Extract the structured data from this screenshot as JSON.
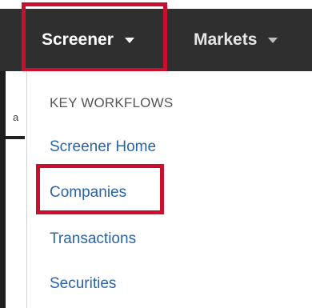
{
  "navbar": {
    "items": [
      {
        "label": "Screener",
        "active": true
      },
      {
        "label": "Markets",
        "active": false
      }
    ]
  },
  "background_page": {
    "visible_fragment": "a"
  },
  "dropdown": {
    "heading": "KEY WORKFLOWS",
    "items": [
      {
        "label": "Screener Home"
      },
      {
        "label": "Companies",
        "highlighted": true
      },
      {
        "label": "Transactions"
      },
      {
        "label": "Securities"
      }
    ]
  },
  "colors": {
    "navbar_bg": "#2f2f2f",
    "link": "#2a64a6",
    "highlight_box": "#c8102e",
    "heading": "#555555"
  }
}
